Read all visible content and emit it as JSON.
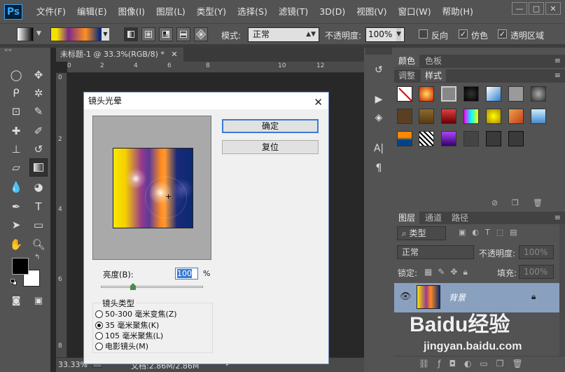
{
  "app": {
    "logo": "Ps"
  },
  "menu": [
    "文件(F)",
    "编辑(E)",
    "图像(I)",
    "图层(L)",
    "类型(Y)",
    "选择(S)",
    "滤镜(T)",
    "3D(D)",
    "视图(V)",
    "窗口(W)",
    "帮助(H)"
  ],
  "window_controls": [
    "—",
    "□",
    "✕"
  ],
  "options": {
    "mode_label": "模式:",
    "mode_value": "正常",
    "opacity_label": "不透明度:",
    "opacity_value": "100%",
    "reverse": "反向",
    "dither": "仿色",
    "transparency": "透明区域"
  },
  "document": {
    "tab_title": "未标题-1 @ 33.3%(RGB/8) *",
    "ruler_h": [
      "0",
      "2",
      "4",
      "6",
      "8",
      "10",
      "12"
    ],
    "ruler_v": [
      "0",
      "2",
      "4",
      "6",
      "8"
    ],
    "zoom": "33.33%",
    "doc_info": "文档:2.86M/2.86M"
  },
  "dialog": {
    "title": "镜头光晕",
    "ok": "确定",
    "reset": "复位",
    "brightness_label": "亮度(B):",
    "brightness_value": "100",
    "brightness_unit": "%",
    "lens_group_title": "镜头类型",
    "lens_options": [
      "50-300 毫米变焦(Z)",
      "35 毫米聚焦(K)",
      "105 毫米聚焦(L)",
      "电影镜头(M)"
    ],
    "selected_lens": "35 毫米聚焦(K)"
  },
  "panels": {
    "top_tabs": [
      "颜色",
      "色板"
    ],
    "second_tabs": [
      "调整",
      "样式"
    ],
    "layer_tabs": [
      "图层",
      "通道",
      "路径"
    ],
    "filter_kind": "类型",
    "blend_mode": "正常",
    "opacity_label": "不透明度:",
    "opacity_value": "100%",
    "lock_label": "锁定:",
    "fill_label": "填充:",
    "fill_value": "100%",
    "layer_name": "背景"
  },
  "watermark": {
    "brand": "Baidu经验",
    "url": "jingyan.baidu.com"
  }
}
